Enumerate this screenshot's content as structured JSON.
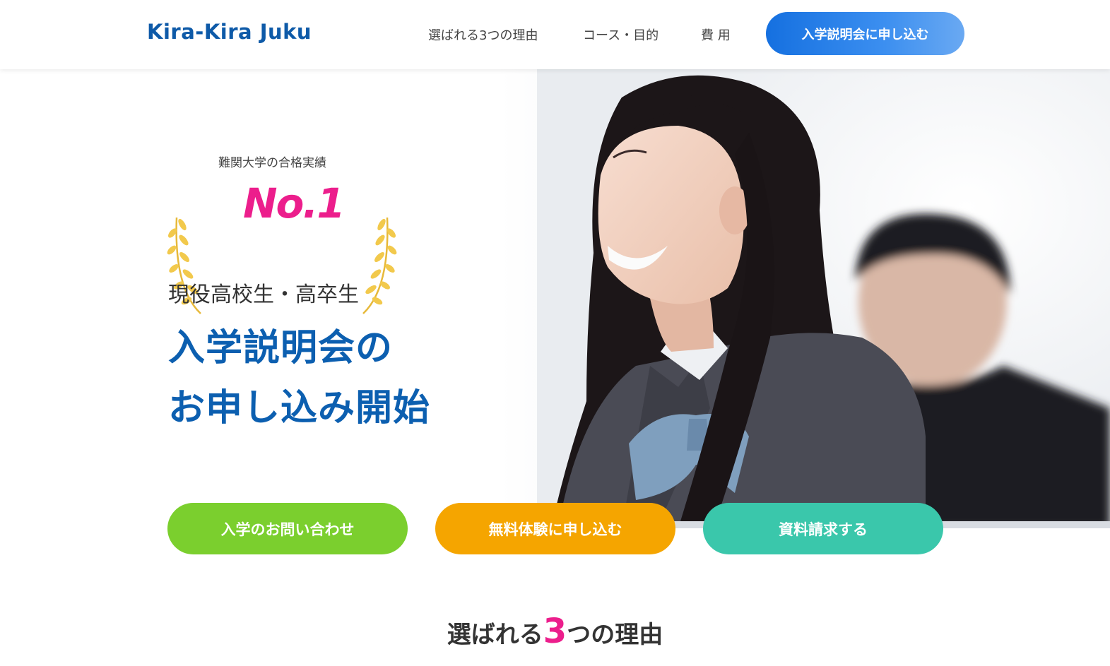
{
  "header": {
    "logo": "Kira-Kira Juku",
    "nav": [
      "選ばれる3つの理由",
      "コース・目的",
      "費 用"
    ],
    "cta_label": "入学説明会に申し込む"
  },
  "hero": {
    "badge_subtitle": "難関大学の合格実績",
    "badge_rank": "No.1",
    "subtitle": "現役高校生・高卒生",
    "title_line1": "入学説明会の",
    "title_line2": "お申し込み開始"
  },
  "cta_buttons": [
    {
      "label": "入学のお問い合わせ",
      "color": "#7bcf2e"
    },
    {
      "label": "無料体験に申し込む",
      "color": "#f5a500"
    },
    {
      "label": "資料請求する",
      "color": "#3ac7ab"
    }
  ],
  "section": {
    "title_pre": "選ばれる",
    "title_num": "3",
    "title_post": "つの理由"
  },
  "colors": {
    "brand_blue": "#0c5fb0",
    "accent_pink": "#ec1e8c",
    "laurel_gold": "#f2c94c"
  }
}
